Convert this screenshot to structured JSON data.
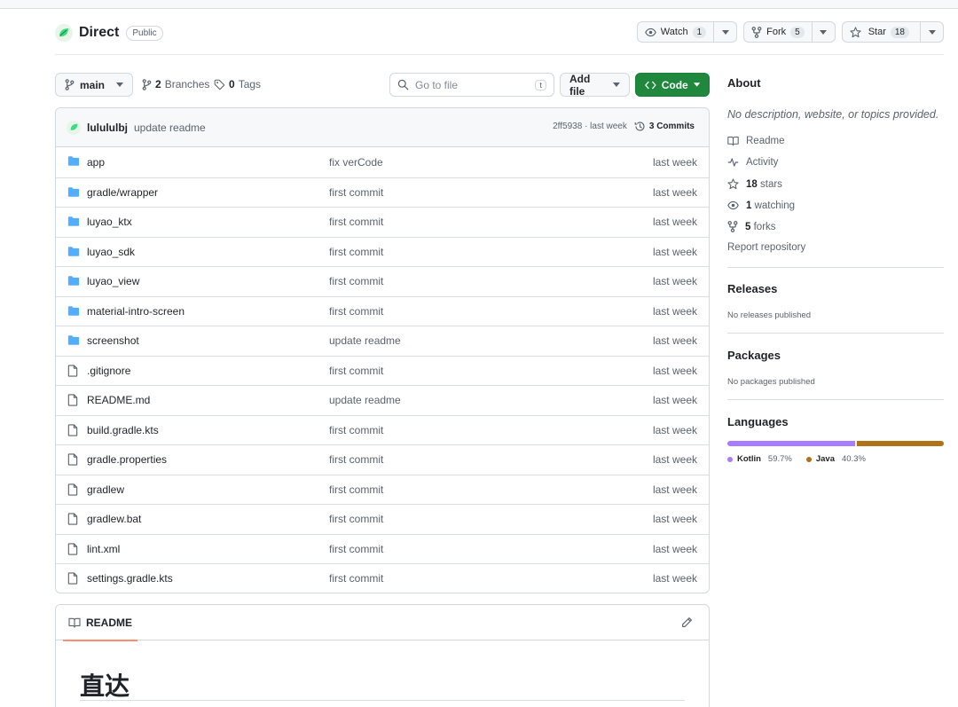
{
  "header": {
    "repo_name": "Direct",
    "visibility": "Public",
    "watch_label": "Watch",
    "watch_count": "1",
    "fork_label": "Fork",
    "fork_count": "5",
    "star_label": "Star",
    "star_count": "18"
  },
  "toolbar": {
    "branch": "main",
    "branches_count": "2",
    "branches_label": "Branches",
    "tags_count": "0",
    "tags_label": "Tags",
    "search_placeholder": "Go to file",
    "search_shortcut": "t",
    "add_file": "Add file",
    "code": "Code"
  },
  "commit": {
    "user": "lulululbj",
    "message": "update readme",
    "hash_time": "2ff5938 · last week",
    "commits": "3 Commits"
  },
  "files": [
    {
      "name": "app",
      "type": "dir",
      "message": "fix verCode",
      "time": "last week"
    },
    {
      "name": "gradle/wrapper",
      "type": "dir",
      "message": "first commit",
      "time": "last week"
    },
    {
      "name": "luyao_ktx",
      "type": "dir",
      "message": "first commit",
      "time": "last week"
    },
    {
      "name": "luyao_sdk",
      "type": "dir",
      "message": "first commit",
      "time": "last week"
    },
    {
      "name": "luyao_view",
      "type": "dir",
      "message": "first commit",
      "time": "last week"
    },
    {
      "name": "material-intro-screen",
      "type": "dir",
      "message": "first commit",
      "time": "last week"
    },
    {
      "name": "screenshot",
      "type": "dir",
      "message": "update readme",
      "time": "last week"
    },
    {
      "name": ".gitignore",
      "type": "file",
      "message": "first commit",
      "time": "last week"
    },
    {
      "name": "README.md",
      "type": "file",
      "message": "update readme",
      "time": "last week"
    },
    {
      "name": "build.gradle.kts",
      "type": "file",
      "message": "first commit",
      "time": "last week"
    },
    {
      "name": "gradle.properties",
      "type": "file",
      "message": "first commit",
      "time": "last week"
    },
    {
      "name": "gradlew",
      "type": "file",
      "message": "first commit",
      "time": "last week"
    },
    {
      "name": "gradlew.bat",
      "type": "file",
      "message": "first commit",
      "time": "last week"
    },
    {
      "name": "lint.xml",
      "type": "file",
      "message": "first commit",
      "time": "last week"
    },
    {
      "name": "settings.gradle.kts",
      "type": "file",
      "message": "first commit",
      "time": "last week"
    }
  ],
  "readme": {
    "tab": "README",
    "heading": "直达"
  },
  "about": {
    "title": "About",
    "description": "No description, website, or topics provided.",
    "readme": "Readme",
    "activity": "Activity",
    "stars_count": "18",
    "stars_label": "stars",
    "watching_count": "1",
    "watching_label": "watching",
    "forks_count": "5",
    "forks_label": "forks",
    "report": "Report repository"
  },
  "releases": {
    "title": "Releases",
    "text": "No releases published"
  },
  "packages": {
    "title": "Packages",
    "text": "No packages published"
  },
  "languages": {
    "title": "Languages",
    "items": [
      {
        "name": "Kotlin",
        "percent": "59.7%",
        "value": 59.7,
        "color": "#a97bff"
      },
      {
        "name": "Java",
        "percent": "40.3%",
        "value": 40.3,
        "color": "#b07219"
      }
    ]
  },
  "colors": {
    "accent_green": "#1f883d",
    "folder_blue": "#54aeff",
    "readme_underline": "#fd8c73"
  }
}
